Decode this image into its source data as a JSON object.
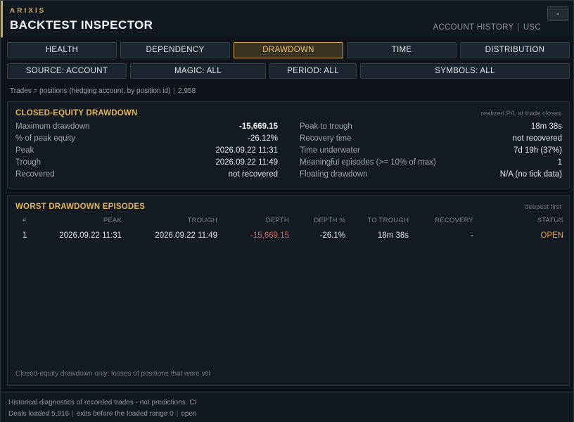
{
  "header": {
    "brand": "ARIXIS",
    "title": "BACKTEST INSPECTOR",
    "meta_left": "ACCOUNT HISTORY",
    "meta_sep": "|",
    "meta_right": "USC",
    "minimize_label": "-"
  },
  "tabs": [
    {
      "label": "HEALTH"
    },
    {
      "label": "DEPENDENCY"
    },
    {
      "label": "DRAWDOWN"
    },
    {
      "label": "TIME"
    },
    {
      "label": "DISTRIBUTION"
    }
  ],
  "active_tab": "DRAWDOWN",
  "filters": [
    {
      "label": "SOURCE: ACCOUNT"
    },
    {
      "label": "MAGIC: ALL"
    },
    {
      "label": "PERIOD: ALL"
    },
    {
      "label": "SYMBOLS: ALL"
    }
  ],
  "trades_note": {
    "text": "Trades = positions (hedging account, by position id)",
    "sep": "|",
    "count": "2,958"
  },
  "closed_equity": {
    "title": "CLOSED-EQUITY DRAWDOWN",
    "note": "realized P/L at trade closes",
    "left": [
      {
        "label": "Maximum drawdown",
        "value": "-15,669.15"
      },
      {
        "label": "% of peak equity",
        "value": "-26.12%"
      },
      {
        "label": "Peak",
        "value": "2026.09.22 11:31"
      },
      {
        "label": "Trough",
        "value": "2026.09.22 11:49"
      },
      {
        "label": "Recovered",
        "value": "not recovered"
      }
    ],
    "right": [
      {
        "label": "Peak to trough",
        "value": "18m 38s"
      },
      {
        "label": "Recovery time",
        "value": "not recovered"
      },
      {
        "label": "Time underwater",
        "value": "7d 19h (37%)"
      },
      {
        "label": "Meaningful episodes (>= 10% of max)",
        "value": "1"
      },
      {
        "label": "Floating drawdown",
        "value": "N/A (no tick data)"
      }
    ]
  },
  "episodes": {
    "title": "WORST DRAWDOWN EPISODES",
    "note": "deepest first",
    "columns": [
      "#",
      "PEAK",
      "TROUGH",
      "DEPTH",
      "DEPTH %",
      "TO TROUGH",
      "RECOVERY",
      "STATUS"
    ],
    "rows": [
      {
        "num": "1",
        "peak": "2026.09.22 11:31",
        "trough": "2026.09.22 11:49",
        "depth": "-15,669.15",
        "depth_pct": "-26.1%",
        "to_trough": "18m 38s",
        "recovery": "-",
        "status": "OPEN"
      }
    ],
    "footnote": "Closed-equity drawdown only: losses of positions that were stil"
  },
  "footer": {
    "line1": "Historical diagnostics of recorded trades - not predictions. CI",
    "line2_a": "Deals loaded 5,916",
    "line2_b": "exits before the loaded range 0",
    "line2_c": "open",
    "sep": "|"
  },
  "colors": {
    "accent": "#d2a54a",
    "negative": "#ea5a5a",
    "status_open": "#e0a13a"
  }
}
